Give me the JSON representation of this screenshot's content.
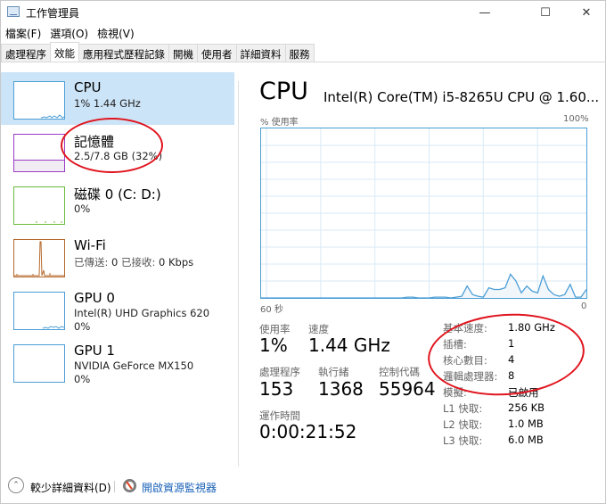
{
  "window": {
    "title": "工作管理員",
    "minimize_icon": "minimize-icon",
    "maximize_icon": "maximize-icon",
    "close_icon": "close-icon"
  },
  "menu": [
    "檔案(F)",
    "選項(O)",
    "檢視(V)"
  ],
  "tabs": [
    {
      "label": "處理程序",
      "active": false
    },
    {
      "label": "效能",
      "active": true
    },
    {
      "label": "應用程式歷程記錄",
      "active": false
    },
    {
      "label": "開機",
      "active": false
    },
    {
      "label": "使用者",
      "active": false
    },
    {
      "label": "詳細資料",
      "active": false
    },
    {
      "label": "服務",
      "active": false
    }
  ],
  "sidebar": [
    {
      "name": "CPU",
      "line1": "1% 1.44 GHz",
      "line2": "",
      "color": "#4b9ed6",
      "selected": true
    },
    {
      "name": "記憶體",
      "line1": "2.5/7.8 GB (32%)",
      "line2": "",
      "color": "#9b3bc4",
      "selected": false,
      "fill": 0.32
    },
    {
      "name": "磁碟 0 (C: D:)",
      "line1": "0%",
      "line2": "",
      "color": "#6cbb3c",
      "selected": false
    },
    {
      "name": "Wi-Fi",
      "line1_a_label": "已傳送:",
      "line1_a_value": "0",
      "line1_b_label": "已接收:",
      "line1_b_value": "0 Kbps",
      "color": "#b5692b",
      "selected": false
    },
    {
      "name": "GPU 0",
      "line1": "Intel(R) UHD Graphics 620",
      "line2": "0%",
      "color": "#4b9ed6",
      "selected": false
    },
    {
      "name": "GPU 1",
      "line1": "NVIDIA GeForce MX150",
      "line2": "0%",
      "color": "#4b9ed6",
      "selected": false
    }
  ],
  "main": {
    "title": "CPU",
    "model": "Intel(R) Core(TM) i5-8265U CPU @ 1.60...",
    "y_label": "% 使用率",
    "y_max_label": "100%",
    "x_left_label": "60 秒",
    "x_right_label": "0",
    "stats": {
      "utilization_label": "使用率",
      "utilization_value": "1%",
      "speed_label": "速度",
      "speed_value": "1.44 GHz",
      "processes_label": "處理程序",
      "processes_value": "153",
      "threads_label": "執行緒",
      "threads_value": "1368",
      "handles_label": "控制代碼",
      "handles_value": "55964",
      "uptime_label": "運作時間",
      "uptime_value": "0:00:21:52"
    },
    "specs": [
      {
        "label": "基本速度:",
        "value": "1.80 GHz"
      },
      {
        "label": "插槽:",
        "value": "1"
      },
      {
        "label": "核心數目:",
        "value": "4"
      },
      {
        "label": "邏輯處理器:",
        "value": "8"
      },
      {
        "label": "模擬:",
        "value": "已啟用"
      },
      {
        "label": "L1 快取:",
        "value": "256 KB"
      },
      {
        "label": "L2 快取:",
        "value": "1.0 MB"
      },
      {
        "label": "L3 快取:",
        "value": "6.0 MB"
      }
    ]
  },
  "chart_data": {
    "type": "area",
    "title": "CPU % 使用率",
    "xlabel": "60 秒 → 0",
    "ylabel": "% 使用率",
    "xlim": [
      60,
      0
    ],
    "ylim": [
      0,
      100
    ],
    "grid": true,
    "x_seconds_ago": [
      60,
      59,
      58,
      57,
      56,
      55,
      54,
      53,
      52,
      51,
      50,
      49,
      48,
      47,
      46,
      45,
      44,
      43,
      42,
      41,
      40,
      39,
      38,
      37,
      36,
      35,
      34,
      33,
      32,
      31,
      30,
      29,
      28,
      27,
      26,
      25,
      24,
      23,
      22,
      21,
      20,
      19,
      18,
      17,
      16,
      15,
      14,
      13,
      12,
      11,
      10,
      9,
      8,
      7,
      6,
      5,
      4,
      3,
      2,
      1,
      0
    ],
    "values": [
      0,
      0,
      0,
      0,
      0,
      0,
      0,
      0,
      0,
      0,
      0,
      0,
      0,
      0,
      0,
      0,
      0,
      0,
      0,
      0,
      0,
      0,
      0,
      0,
      0,
      0,
      0,
      0.5,
      0.5,
      0,
      0,
      0,
      0.5,
      0.5,
      0.5,
      0,
      0.5,
      1,
      7,
      2,
      1,
      0.5,
      6,
      5,
      5,
      6,
      14,
      10,
      3,
      7,
      4,
      3,
      13,
      5,
      2,
      1,
      2,
      8,
      0.5,
      0.5,
      5,
      1
    ]
  },
  "footer": {
    "less_details": "較少詳細資料(D)",
    "resource_monitor": "開啟資源監視器"
  }
}
